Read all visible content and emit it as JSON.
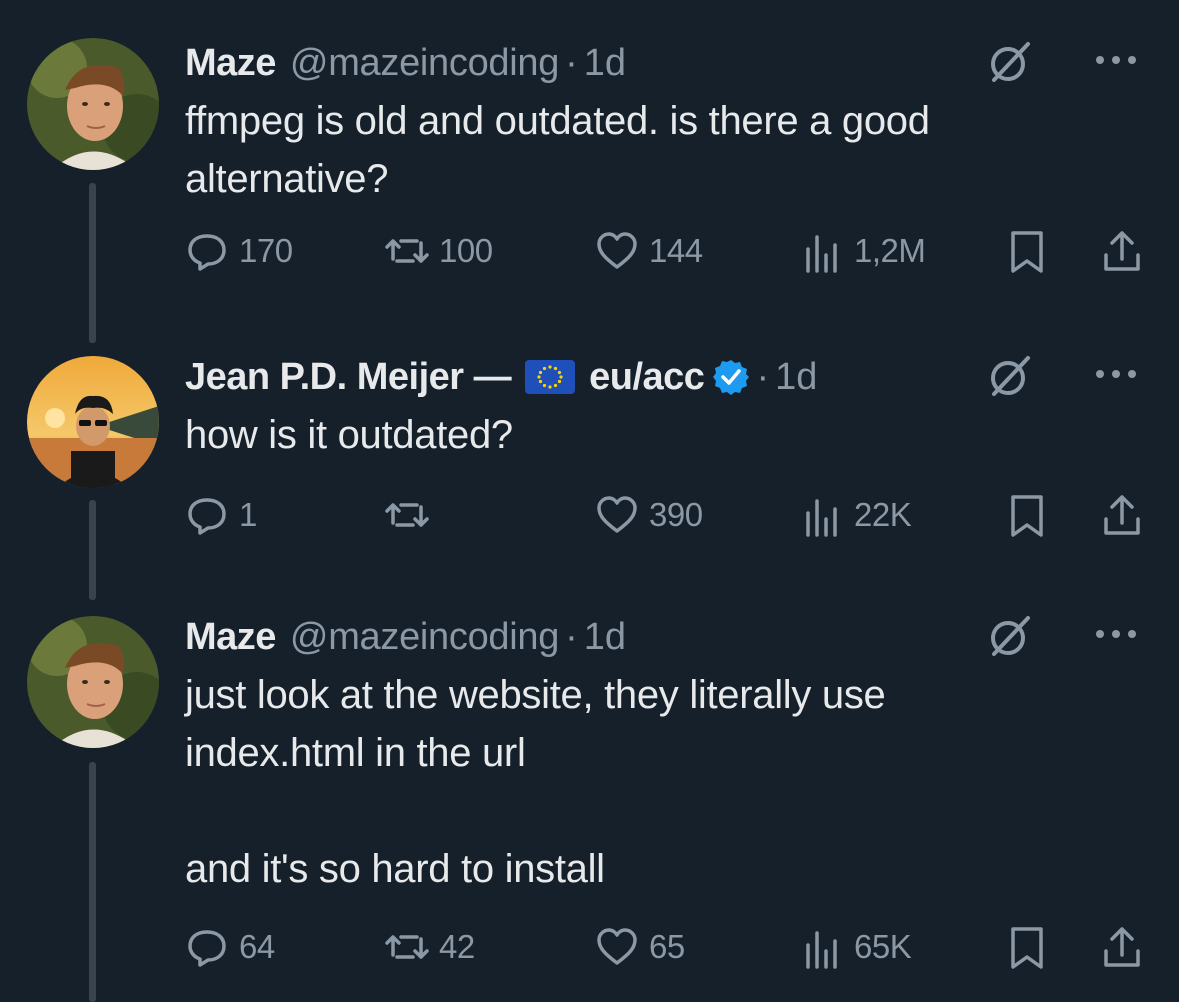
{
  "tweets": [
    {
      "name": "Maze",
      "handle": "@mazeincoding",
      "dot": "·",
      "time": "1d",
      "text": "ffmpeg is old and outdated. is there a good\nalternative?",
      "replies": "170",
      "retweets": "100",
      "likes": "144",
      "views": "1,2M",
      "avatar_icon": "profile-photo"
    },
    {
      "name_prefix": "Jean P.D. Meijer —",
      "name_suffix": "eu/acc",
      "flag_icon": "eu-flag-icon",
      "verified_icon": "verified-badge-icon",
      "dot": "·",
      "time": "1d",
      "text": "how is it outdated?",
      "replies": "1",
      "retweets": "",
      "likes": "390",
      "views": "22K",
      "avatar_icon": "profile-photo"
    },
    {
      "name": "Maze",
      "handle": "@mazeincoding",
      "dot": "·",
      "time": "1d",
      "text": "just look at the website, they literally use\nindex.html in the url\n\nand it's so hard to install",
      "replies": "64",
      "retweets": "42",
      "likes": "65",
      "views": "65K",
      "avatar_icon": "profile-photo"
    }
  ],
  "colors": {
    "background": "#15202b",
    "text": "#e7e9ea",
    "muted": "#8b98a5",
    "thread_line": "#38444d",
    "verified": "#1d9bf0"
  }
}
